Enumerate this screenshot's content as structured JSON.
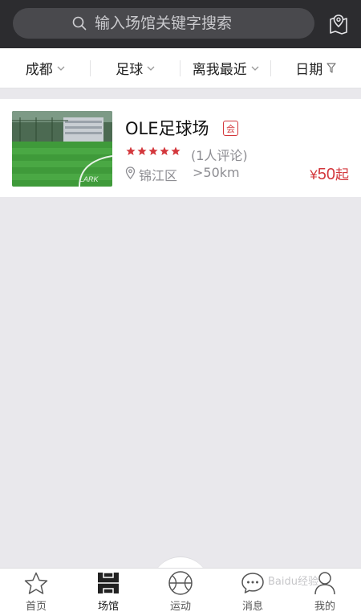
{
  "search": {
    "placeholder": "输入场馆关键字搜索"
  },
  "filters": [
    {
      "label": "成都"
    },
    {
      "label": "足球"
    },
    {
      "label": "离我最近"
    },
    {
      "label": "日期"
    }
  ],
  "venue": {
    "name": "OLE足球场",
    "badge": "会",
    "rating_stars": 5,
    "review_text": "(1人评论)",
    "district": "锦江区",
    "distance": ">50km",
    "price_symbol": "¥",
    "price_value": "50",
    "price_suffix": "起",
    "thumb_label": "LARK"
  },
  "tabs": [
    {
      "label": "首页",
      "icon": "star-icon"
    },
    {
      "label": "场馆",
      "icon": "venue-icon"
    },
    {
      "label": "运动",
      "icon": "ball-icon"
    },
    {
      "label": "消息",
      "icon": "message-icon"
    },
    {
      "label": "我的",
      "icon": "profile-icon"
    }
  ],
  "watermark": "Baidu经验",
  "colors": {
    "header_bg": "#2c2c2f",
    "accent_red": "#d3373c",
    "muted_text": "#8d8d92",
    "page_bg": "#e9e8ec"
  }
}
